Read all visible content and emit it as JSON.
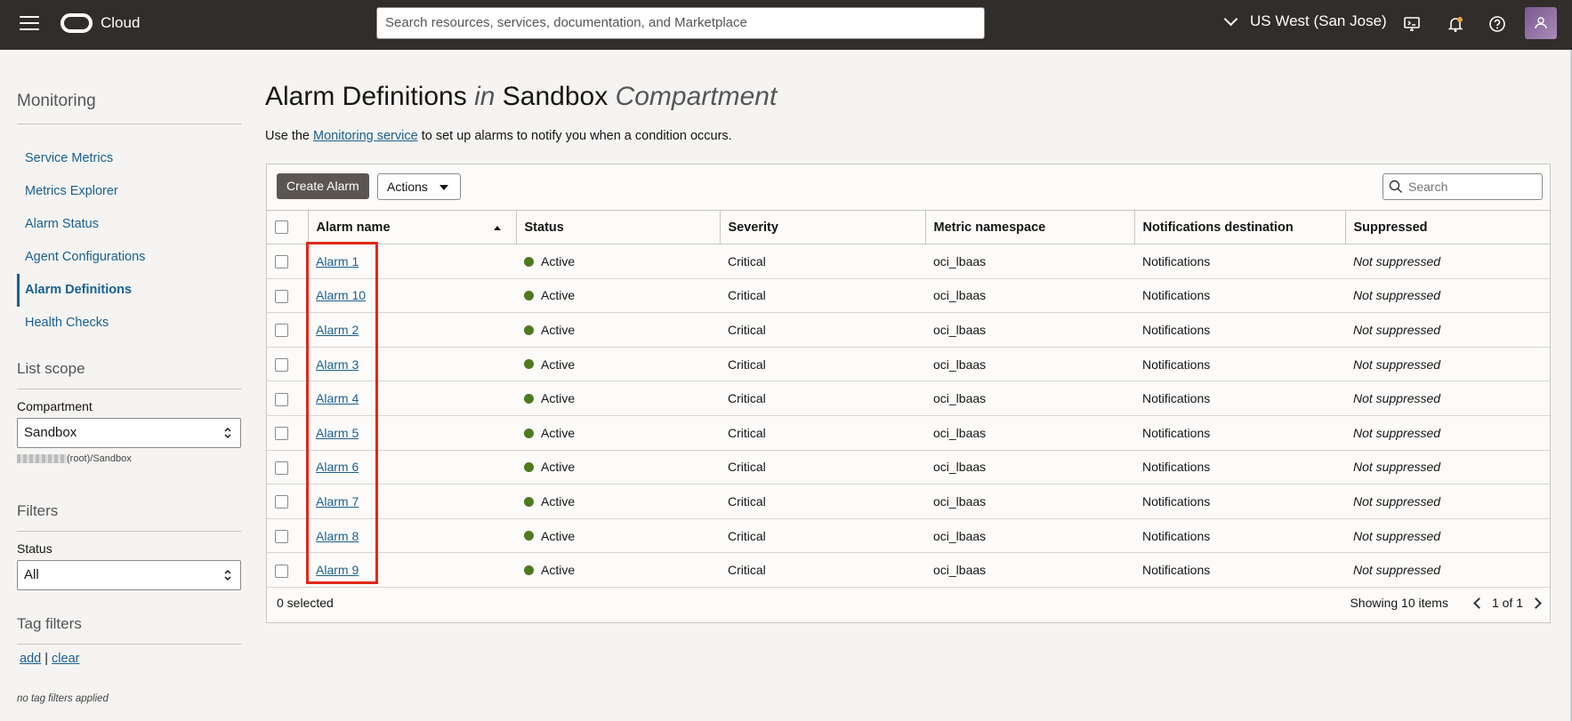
{
  "topbar": {
    "brand": "Cloud",
    "search_placeholder": "Search resources, services, documentation, and Marketplace",
    "region": "US West (San Jose)"
  },
  "sidebar": {
    "title": "Monitoring",
    "items": [
      {
        "label": "Service Metrics"
      },
      {
        "label": "Metrics Explorer"
      },
      {
        "label": "Alarm Status"
      },
      {
        "label": "Agent Configurations"
      },
      {
        "label": "Alarm Definitions",
        "active": true
      },
      {
        "label": "Health Checks"
      }
    ],
    "list_scope": {
      "heading": "List scope",
      "compartment_label": "Compartment",
      "compartment_value": "Sandbox",
      "path": "(root)/Sandbox"
    },
    "filters": {
      "heading": "Filters",
      "status_label": "Status",
      "status_value": "All"
    },
    "tag_filters": {
      "heading": "Tag filters",
      "add": "add",
      "separator": "|",
      "clear": "clear",
      "note": "no tag filters applied"
    }
  },
  "main": {
    "title_part1": "Alarm Definitions",
    "title_in": "in",
    "title_part2": "Sandbox",
    "title_part3": "Compartment",
    "desc_before": "Use the ",
    "desc_link": "Monitoring service",
    "desc_after": " to set up alarms to notify you when a condition occurs.",
    "create_button": "Create Alarm",
    "actions_button": "Actions",
    "search_placeholder": "Search",
    "columns": [
      "Alarm name",
      "Status",
      "Severity",
      "Metric namespace",
      "Notifications destination",
      "Suppressed"
    ],
    "rows": [
      {
        "name": "Alarm 1",
        "status": "Active",
        "severity": "Critical",
        "namespace": "oci_lbaas",
        "destination": "Notifications",
        "suppressed": "Not suppressed"
      },
      {
        "name": "Alarm 10",
        "status": "Active",
        "severity": "Critical",
        "namespace": "oci_lbaas",
        "destination": "Notifications",
        "suppressed": "Not suppressed"
      },
      {
        "name": "Alarm 2",
        "status": "Active",
        "severity": "Critical",
        "namespace": "oci_lbaas",
        "destination": "Notifications",
        "suppressed": "Not suppressed"
      },
      {
        "name": "Alarm 3",
        "status": "Active",
        "severity": "Critical",
        "namespace": "oci_lbaas",
        "destination": "Notifications",
        "suppressed": "Not suppressed"
      },
      {
        "name": "Alarm 4",
        "status": "Active",
        "severity": "Critical",
        "namespace": "oci_lbaas",
        "destination": "Notifications",
        "suppressed": "Not suppressed"
      },
      {
        "name": "Alarm 5",
        "status": "Active",
        "severity": "Critical",
        "namespace": "oci_lbaas",
        "destination": "Notifications",
        "suppressed": "Not suppressed"
      },
      {
        "name": "Alarm 6",
        "status": "Active",
        "severity": "Critical",
        "namespace": "oci_lbaas",
        "destination": "Notifications",
        "suppressed": "Not suppressed"
      },
      {
        "name": "Alarm 7",
        "status": "Active",
        "severity": "Critical",
        "namespace": "oci_lbaas",
        "destination": "Notifications",
        "suppressed": "Not suppressed"
      },
      {
        "name": "Alarm 8",
        "status": "Active",
        "severity": "Critical",
        "namespace": "oci_lbaas",
        "destination": "Notifications",
        "suppressed": "Not suppressed"
      },
      {
        "name": "Alarm 9",
        "status": "Active",
        "severity": "Critical",
        "namespace": "oci_lbaas",
        "destination": "Notifications",
        "suppressed": "Not suppressed"
      }
    ],
    "selected_text": "0 selected",
    "showing_text": "Showing 10 items",
    "page_text": "1 of 1"
  },
  "colors": {
    "topbar": "#312d2a",
    "link": "#1b5f8f",
    "active_dot": "#4d7a1f",
    "highlight": "#e0271a"
  }
}
